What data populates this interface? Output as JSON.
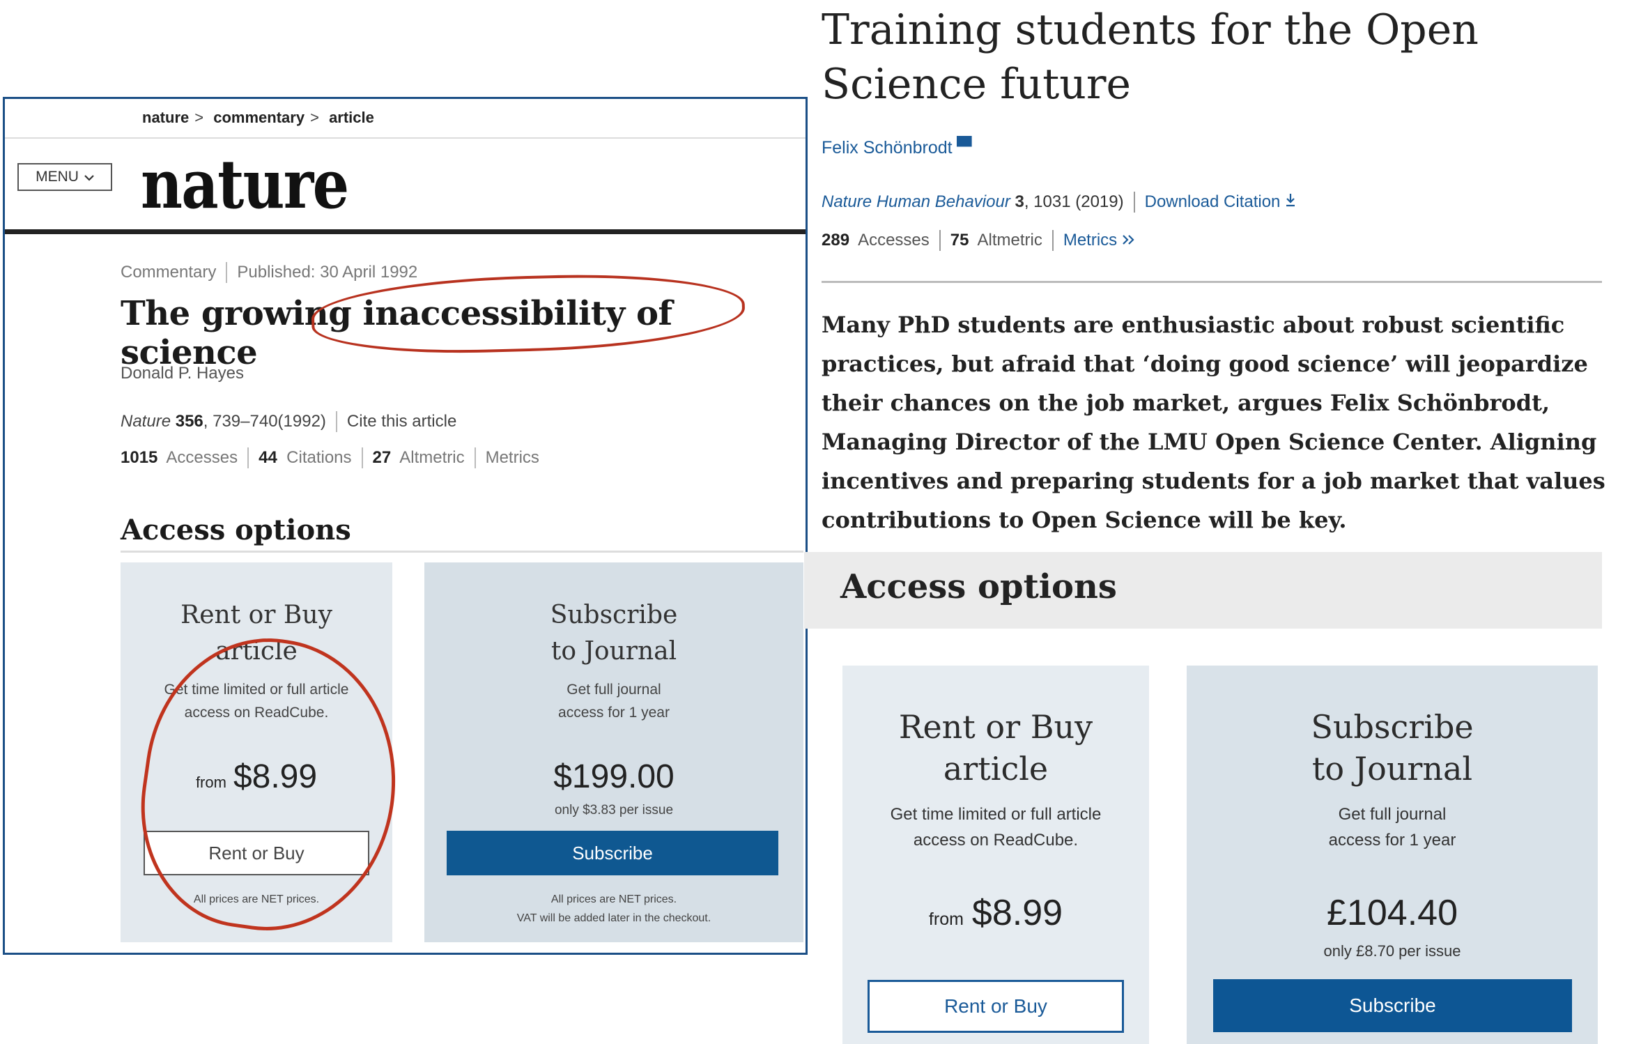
{
  "left": {
    "breadcrumb": [
      "nature",
      "commentary",
      "article"
    ],
    "breadcrumb_sep": ">",
    "menu_label": "MENU",
    "logo": "nature",
    "article_type": "Commentary",
    "published": "Published: 30 April 1992",
    "title": "The growing inaccessibility of science",
    "author": "Donald P. Hayes",
    "journal_name": "Nature",
    "volume": "356",
    "pages": ", 739–740(1992)",
    "cite_link": "Cite this article",
    "stats": {
      "accesses_num": "1015",
      "accesses_label": "Accesses",
      "citations_num": "44",
      "citations_label": "Citations",
      "altmetric_num": "27",
      "altmetric_label": "Altmetric",
      "metrics_link": "Metrics"
    },
    "access_heading": "Access options",
    "rent_card": {
      "title": "Rent or Buy article",
      "desc": "Get time limited or full article access on ReadCube.",
      "from": "from",
      "price": "$8.99",
      "button": "Rent or Buy",
      "note": "All prices are NET prices."
    },
    "sub_card": {
      "title": "Subscribe to Journal",
      "desc": "Get full journal access for 1 year",
      "price": "$199.00",
      "per_issue": "only $3.83 per issue",
      "button": "Subscribe",
      "note1": "All prices are NET prices.",
      "note2": "VAT will be added later in the checkout."
    }
  },
  "right": {
    "title": "Training students for the Open Science future",
    "author": "Felix Schönbrodt",
    "journal_name": "Nature Human Behaviour",
    "volume": "3",
    "pages": ", 1031 (2019)",
    "download_link": "Download Citation",
    "stats": {
      "accesses_num": "289",
      "accesses_label": "Accesses",
      "altmetric_num": "75",
      "altmetric_label": "Altmetric",
      "metrics_link": "Metrics"
    },
    "abstract": "Many PhD students are enthusiastic about robust scientific practices, but afraid that ‘doing good science’ will jeopardize their chances on the job market, argues Felix Schönbrodt, Managing Director of the LMU Open Science Center. Aligning incentives and preparing students for a job market that values contributions to Open Science will be key.",
    "access_heading": "Access options",
    "rent_card": {
      "title_line1": "Rent or Buy",
      "title_line2": "article",
      "desc_line1": "Get time limited or full article",
      "desc_line2": "access on ReadCube.",
      "from": "from",
      "price": "$8.99",
      "button": "Rent or Buy"
    },
    "sub_card": {
      "title_line1": "Subscribe",
      "title_line2": "to Journal",
      "desc_line1": "Get full journal",
      "desc_line2": "access for 1 year",
      "price": "£104.40",
      "per_issue": "only £8.70 per issue",
      "button": "Subscribe"
    }
  },
  "colors": {
    "nature_blue": "#0f5891",
    "link_blue": "#1a5a98",
    "annotation_red": "#b8321f",
    "frame_blue": "#1b4f86"
  }
}
